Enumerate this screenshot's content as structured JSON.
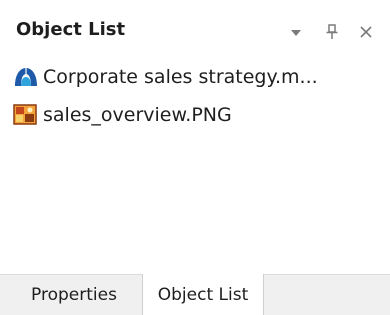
{
  "panel": {
    "title": "Object List",
    "header_icons": [
      "chevron-down-icon",
      "pin-icon",
      "close-icon"
    ]
  },
  "object_list": {
    "items": [
      {
        "label": "Corporate sales strategy.m...",
        "icon": "mindmap-logo-icon",
        "icon_color": "#1f5aa8"
      },
      {
        "label": "sales_overview.PNG",
        "icon": "png-image-icon",
        "icon_color": "#c2451b"
      }
    ]
  },
  "tabs": [
    {
      "label": "Properties",
      "active": false
    },
    {
      "label": "Object List",
      "active": true
    }
  ],
  "colors": {
    "text": "#1e1e1e",
    "tab_bar_bg": "#f0f0f0",
    "active_tab_bg": "#ffffff",
    "header_icon": "#7a7a7a"
  }
}
